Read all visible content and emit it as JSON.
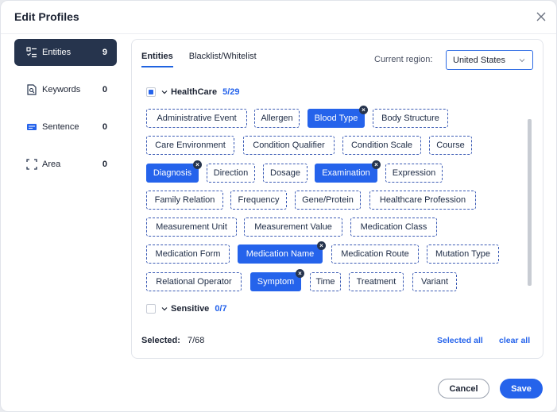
{
  "dialog": {
    "title": "Edit Profiles"
  },
  "sidebar": {
    "items": [
      {
        "label": "Entities",
        "count": "9",
        "icon": "entities-icon",
        "active": true
      },
      {
        "label": "Keywords",
        "count": "0",
        "icon": "keywords-icon",
        "active": false
      },
      {
        "label": "Sentence",
        "count": "0",
        "icon": "sentence-icon",
        "active": false
      },
      {
        "label": "Area",
        "count": "0",
        "icon": "area-icon",
        "active": false
      }
    ]
  },
  "tabs": [
    {
      "label": "Entities",
      "active": true
    },
    {
      "label": "Blacklist/Whitelist",
      "active": false
    }
  ],
  "region": {
    "label": "Current region:",
    "value": "United States"
  },
  "groups": [
    {
      "name": "HealthCare",
      "count": "5/29",
      "state": "partial",
      "expanded": true,
      "rows": [
        [
          {
            "label": "Administrative Event",
            "selected": false
          },
          {
            "label": "Allergen",
            "selected": false
          },
          {
            "label": "Blood Type",
            "selected": true
          },
          {
            "label": "Body Structure",
            "selected": false
          }
        ],
        [
          {
            "label": "Care Environment",
            "selected": false
          },
          {
            "label": "Condition Qualifier",
            "selected": false
          },
          {
            "label": "Condition Scale",
            "selected": false
          },
          {
            "label": "Course",
            "selected": false
          }
        ],
        [
          {
            "label": "Diagnosis",
            "selected": true
          },
          {
            "label": "Direction",
            "selected": false
          },
          {
            "label": "Dosage",
            "selected": false
          },
          {
            "label": "Examination",
            "selected": true
          },
          {
            "label": "Expression",
            "selected": false
          }
        ],
        [
          {
            "label": "Family Relation",
            "selected": false
          },
          {
            "label": "Frequency",
            "selected": false
          },
          {
            "label": "Gene/Protein",
            "selected": false
          },
          {
            "label": "Healthcare Profession",
            "selected": false
          }
        ],
        [
          {
            "label": "Measurement Unit",
            "selected": false
          },
          {
            "label": "Measurement Value",
            "selected": false
          },
          {
            "label": "Medication Class",
            "selected": false
          }
        ],
        [
          {
            "label": "Medication Form",
            "selected": false
          },
          {
            "label": "Medication Name",
            "selected": true
          },
          {
            "label": "Medication Route",
            "selected": false
          },
          {
            "label": "Mutation Type",
            "selected": false
          }
        ],
        [
          {
            "label": "Relational Operator",
            "selected": false
          },
          {
            "label": "Symptom",
            "selected": true
          },
          {
            "label": "Time",
            "selected": false
          },
          {
            "label": "Treatment",
            "selected": false
          },
          {
            "label": "Variant",
            "selected": false
          }
        ]
      ]
    },
    {
      "name": "Sensitive",
      "count": "0/7",
      "state": "unchecked",
      "expanded": false
    }
  ],
  "summary": {
    "label": "Selected:",
    "value": "7/68"
  },
  "actions": {
    "select_all": "Selected all",
    "clear_all": "clear all",
    "cancel": "Cancel",
    "save": "Save"
  },
  "colors": {
    "accent": "#2563eb",
    "dark": "#26344d"
  }
}
